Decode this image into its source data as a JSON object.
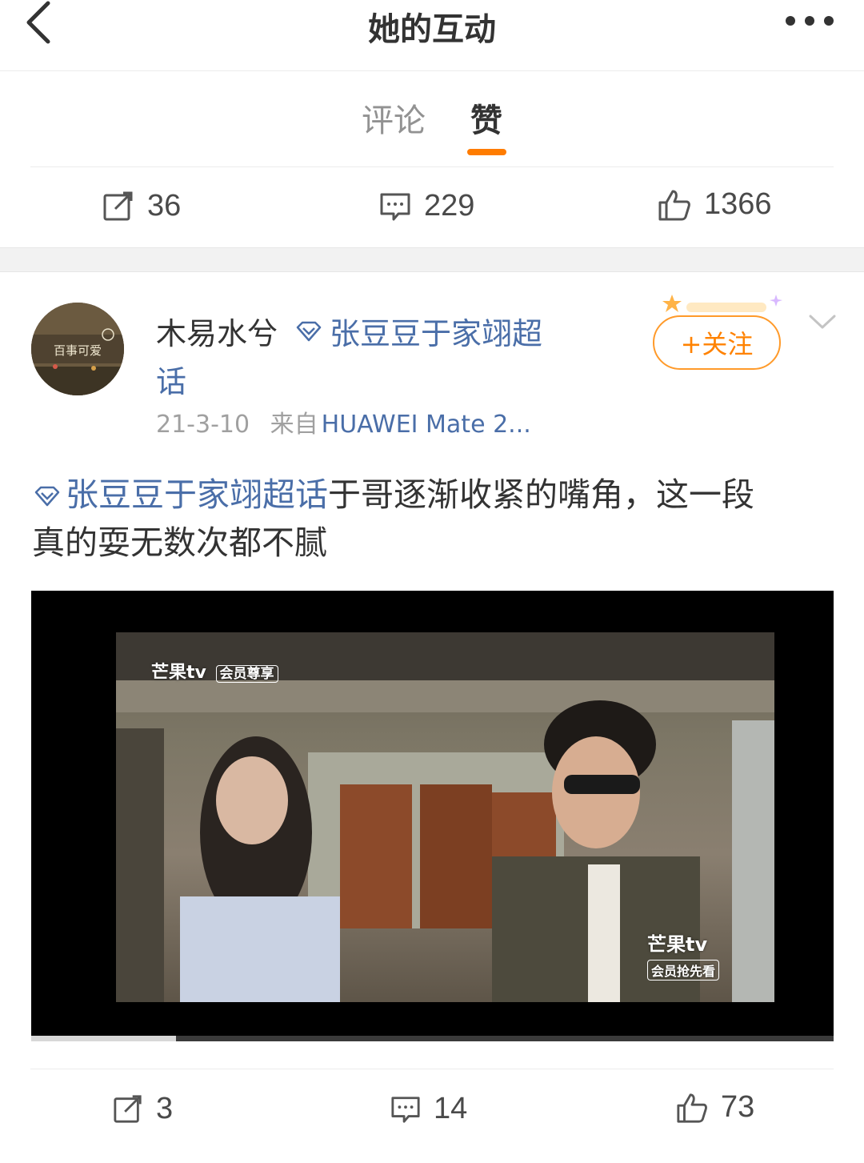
{
  "header": {
    "title": "她的互动"
  },
  "tabs": [
    {
      "label": "评论",
      "active": false
    },
    {
      "label": "赞",
      "active": true
    }
  ],
  "top_actions": {
    "repost": "36",
    "comment": "229",
    "like": "1366"
  },
  "post": {
    "username": "木易水兮",
    "topic_part1": "张豆豆于家翊超",
    "topic_part2": "话",
    "date": "21-3-10",
    "source_prefix": "来自",
    "source": "HUAWEI Mate 2...",
    "follow_label": "+关注",
    "text_topic": "张豆豆于家翊超话",
    "text_line1": "于哥逐渐收紧的嘴角，这一段",
    "text_line2": "真的耍无数次都不腻",
    "avatar_text": "百事可爱",
    "video": {
      "watermark_top": "芒果tv",
      "watermark_top_badge": "会员尊享",
      "watermark_bottom": "芒果tv",
      "watermark_bottom_badge": "会员抢先看",
      "progress": 0.18
    }
  },
  "bottom_actions": {
    "repost": "3",
    "comment": "14",
    "like": "73"
  },
  "colors": {
    "accent": "#ff8200",
    "link": "#4a6ea8",
    "tab_indicator": "#ff7c00"
  }
}
